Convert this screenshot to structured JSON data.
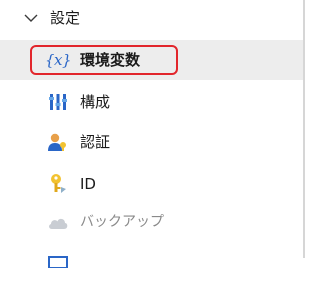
{
  "section": {
    "title": "設定",
    "expanded": true
  },
  "items": [
    {
      "label": "環境変数",
      "icon": "variable-icon",
      "selected": true
    },
    {
      "label": "構成",
      "icon": "configuration-bars-icon",
      "selected": false
    },
    {
      "label": "認証",
      "icon": "user-auth-icon",
      "selected": false
    },
    {
      "label": "ID",
      "icon": "key-identity-icon",
      "selected": false
    },
    {
      "label": "バックアップ",
      "icon": "cloud-backup-icon",
      "selected": false,
      "disabled": true
    }
  ],
  "colors": {
    "selected_background": "#ededed",
    "highlight_border": "#e2262c",
    "variable_icon": "#2a66c7",
    "disabled_text": "#8a8a8a"
  }
}
